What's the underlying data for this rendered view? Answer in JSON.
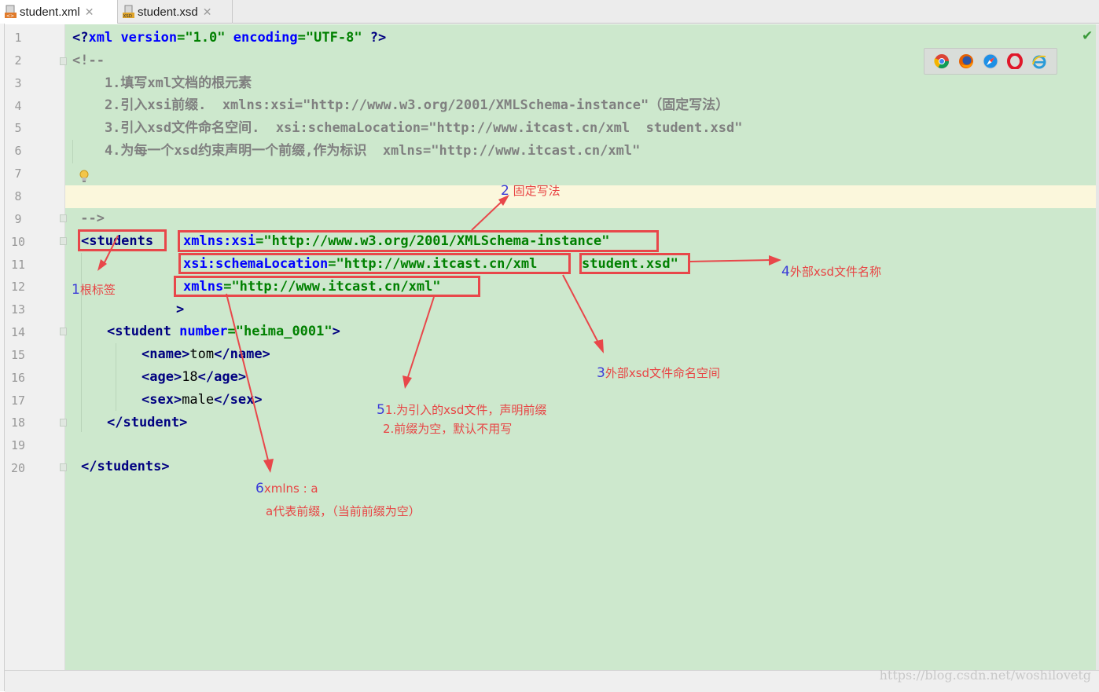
{
  "tabs": [
    {
      "label": "student.xml",
      "active": true
    },
    {
      "label": "student.xsd",
      "active": false
    }
  ],
  "line_numbers": [
    "1",
    "2",
    "3",
    "4",
    "5",
    "6",
    "7",
    "8",
    "9",
    "10",
    "11",
    "12",
    "13",
    "14",
    "15",
    "16",
    "17",
    "18",
    "19",
    "20"
  ],
  "code": {
    "l1_a": "<?",
    "l1_b": "xml",
    "l1_c": " version",
    "l1_d": "=",
    "l1_e": "\"1.0\"",
    "l1_f": " encoding",
    "l1_g": "=",
    "l1_h": "\"UTF-8\"",
    "l1_i": " ?>",
    "l2": "<!--",
    "l3": "    1.填写xml文档的根元素",
    "l4": "    2.引入xsi前缀.  xmlns:xsi=\"http://www.w3.org/2001/XMLSchema-instance\"（固定写法）",
    "l5": "    3.引入xsd文件命名空间.  xsi:schemaLocation=\"http://www.itcast.cn/xml  student.xsd\"",
    "l6": "    4.为每一个xsd约束声明一个前缀,作为标识  xmlns=\"http://www.itcast.cn/xml\"",
    "l9": " -->",
    "l10_tag": "<students",
    "l10_attr": "xmlns:xsi",
    "l10_eq": "=",
    "l10_val": "\"http://www.w3.org/2001/XMLSchema-instance\"",
    "l11_attr": "xsi:schemaLocation",
    "l11_eq": "=",
    "l11_val1": "\"http://www.itcast.cn/xml",
    "l11_val2": "student.xsd\"",
    "l12_attr": "xmlns",
    "l12_eq": "=",
    "l12_val": "\"http://www.itcast.cn/xml\"",
    "l13": ">",
    "l14_tag": "<student",
    "l14_attr": " number",
    "l14_eq": "=",
    "l14_val": "\"heima_0001\"",
    "l14_end": ">",
    "l15_open": "<name>",
    "l15_text": "tom",
    "l15_close": "</name>",
    "l16_open": "<age>",
    "l16_text": "18",
    "l16_close": "</age>",
    "l17_open": "<sex>",
    "l17_text": "male",
    "l17_close": "</sex>",
    "l18": "</student>",
    "l20": "</students>"
  },
  "annotations": {
    "a1_num": "1",
    "a1_text": "根标签",
    "a2_num": "2",
    "a2_text": "固定写法",
    "a3_num": "3",
    "a3_text": "外部xsd文件命名空间",
    "a4_num": "4",
    "a4_text": "外部xsd文件名称",
    "a5_num": "5",
    "a5_line1": "1.为引入的xsd文件，声明前缀",
    "a5_line2": "2.前缀为空，默认不用写",
    "a6_num": "6",
    "a6_line1": "xmlns : a",
    "a6_line2": "a代表前缀，（当前前缀为空）"
  },
  "browser_icons": [
    "chrome-icon",
    "firefox-icon",
    "safari-icon",
    "opera-icon",
    "ie-icon"
  ],
  "watermark": "https://blog.csdn.net/woshilovetg",
  "colors": {
    "editor_bg": "#cde8cd",
    "annotation_red": "#e84444",
    "annotation_blue": "#3a3ad8",
    "tag": "#000080",
    "attribute": "#0000ff",
    "value": "#008000",
    "comment": "#808080"
  }
}
